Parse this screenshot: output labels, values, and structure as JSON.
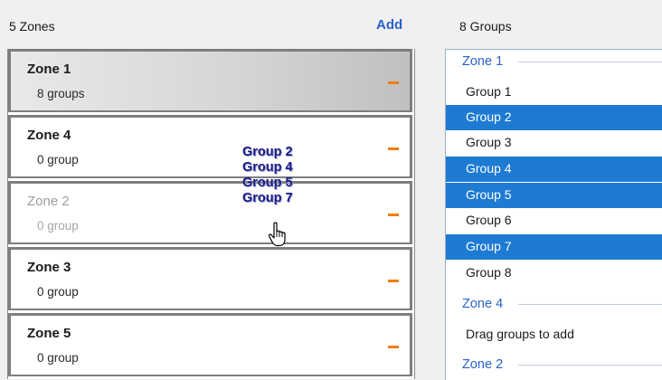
{
  "header": {
    "zones_count": "5 Zones",
    "add_label": "Add",
    "groups_count": "8 Groups"
  },
  "zones": [
    {
      "name": "Zone 1",
      "sub": "8 groups",
      "state": "selected"
    },
    {
      "name": "Zone 4",
      "sub": "0 group",
      "state": "normal"
    },
    {
      "name": "Zone 2",
      "sub": "0 group",
      "state": "dimmed"
    },
    {
      "name": "Zone 3",
      "sub": "0 group",
      "state": "normal"
    },
    {
      "name": "Zone 5",
      "sub": "0 group",
      "state": "normal"
    }
  ],
  "drag_ghost": [
    "Group 2",
    "Group 4",
    "Group 5",
    "Group 7"
  ],
  "groups_panel": {
    "zone1_header": "Zone 1",
    "items": [
      {
        "label": "Group 1",
        "selected": false
      },
      {
        "label": "Group 2",
        "selected": true
      },
      {
        "label": "Group 3",
        "selected": false
      },
      {
        "label": "Group 4",
        "selected": true
      },
      {
        "label": "Group 5",
        "selected": true
      },
      {
        "label": "Group 6",
        "selected": false
      },
      {
        "label": "Group 7",
        "selected": true
      },
      {
        "label": "Group 8",
        "selected": false
      }
    ],
    "zone4_header": "Zone 4",
    "zone4_placeholder": "Drag groups to add",
    "zone2_header": "Zone 2"
  },
  "colors": {
    "accent": "#2a62c9",
    "selection": "#1e7bd3",
    "remove": "#f07d12",
    "drag_text": "#1a1a82"
  },
  "icons": {
    "remove": "minus-icon",
    "cursor": "hand-pointer-icon"
  }
}
